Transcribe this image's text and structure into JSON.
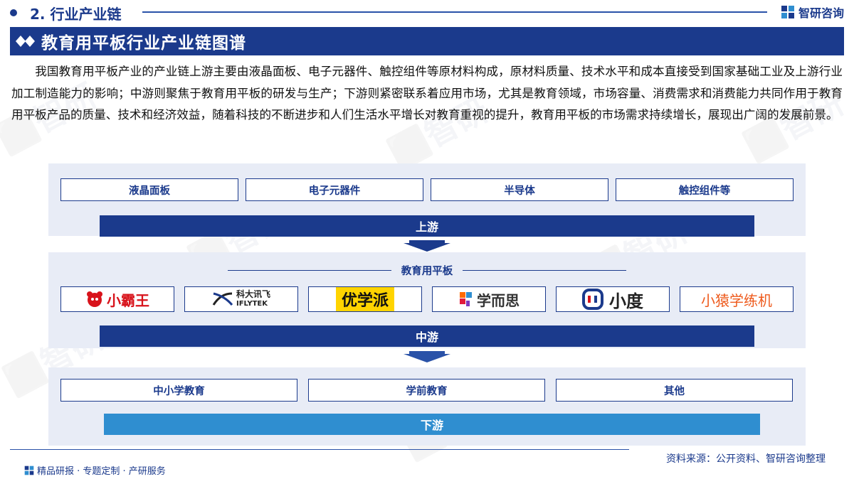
{
  "header": {
    "section_title": "2. 行业产业链",
    "brand": "智研咨询"
  },
  "title": "教育用平板行业产业链图谱",
  "intro": "我国教育用平板产业的产业链上游主要由液晶面板、电子元器件、触控组件等原材料构成，原材料质量、技术水平和成本直接受到国家基础工业及上游行业加工制造能力的影响；中游则聚焦于教育用平板的研发与生产；下游则紧密联系着应用市场，尤其是教育领域，市场容量、消费需求和消费能力共同作用于教育用平板产品的质量、技术和经济效益，随着科技的不断进步和人们生活水平增长对教育重视的提升，教育用平板的市场需求持续增长，展现出广阔的发展前景。",
  "upstream": {
    "items": [
      "液晶面板",
      "电子元器件",
      "半导体",
      "触控组件等"
    ],
    "label": "上游"
  },
  "midstream": {
    "product": "教育用平板",
    "brands": [
      "小霸王",
      "科大讯飞",
      "IFLYTEK",
      "优学派",
      "学而思",
      "小度",
      "小猿学练机"
    ],
    "label": "中游"
  },
  "downstream": {
    "items": [
      "中小学教育",
      "学前教育",
      "其他"
    ],
    "label": "下游"
  },
  "footer": {
    "source": "资料来源：公开资料、智研咨询整理",
    "tagline": "精品研报 · 专题定制 · 产研服务"
  },
  "colors": {
    "primary": "#1b3a8c",
    "downstream_bar": "#2f8ed0",
    "panel": "#e8ecf6"
  },
  "icons": [
    "brand-logo-icon",
    "diamond-icon",
    "down-arrow-icon"
  ]
}
